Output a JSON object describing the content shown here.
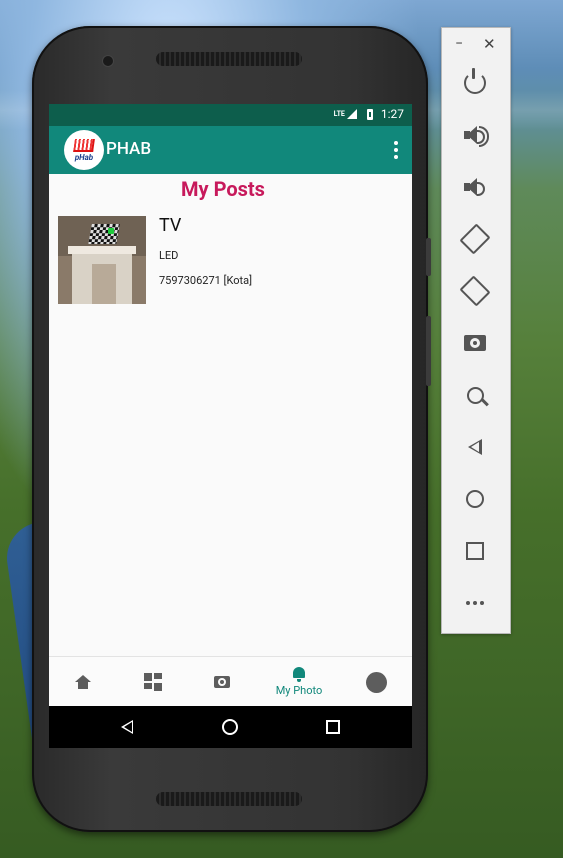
{
  "status_bar": {
    "network": "LTE",
    "time": "1:27"
  },
  "app_bar": {
    "logo_text": "pHab",
    "title": "PHAB"
  },
  "page": {
    "title": "My Posts"
  },
  "posts": [
    {
      "title": "TV",
      "subtitle": "LED",
      "contact": "7597306271 [Kota]"
    }
  ],
  "bottom_nav": {
    "items": [
      {
        "icon": "home-icon",
        "label": ""
      },
      {
        "icon": "dashboard-icon",
        "label": ""
      },
      {
        "icon": "camera-icon",
        "label": ""
      },
      {
        "icon": "bell-icon",
        "label": "My Photo",
        "active": true
      },
      {
        "icon": "profile-icon",
        "label": ""
      }
    ]
  },
  "system_nav": {
    "icons": [
      "back-icon",
      "home-circle-icon",
      "recents-icon"
    ]
  },
  "emulator_toolbar": {
    "window": {
      "minimize": "−",
      "close": "✕"
    },
    "buttons": [
      "power",
      "volume-up",
      "volume-down",
      "rotate-left",
      "rotate-right",
      "screenshot",
      "zoom",
      "back",
      "home",
      "overview",
      "more"
    ]
  },
  "colors": {
    "primary": "#11887b",
    "status": "#0d5e4c",
    "accent": "#c7195b"
  }
}
